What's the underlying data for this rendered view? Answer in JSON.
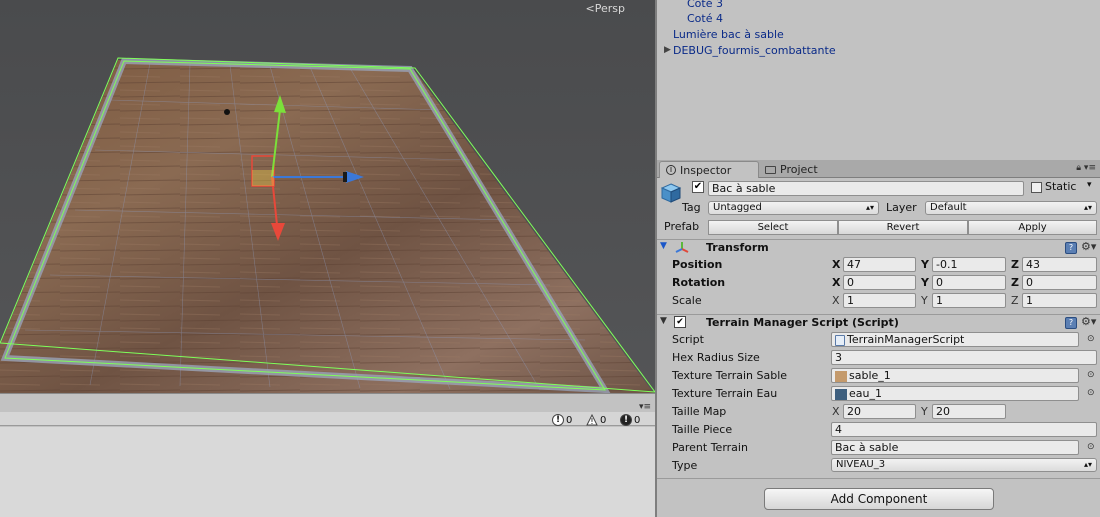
{
  "scene": {
    "projection_label": "Persp"
  },
  "console": {
    "log_count": "0",
    "warning_count": "0",
    "error_count": "0"
  },
  "hierarchy": {
    "items": [
      {
        "label": "Coté 3"
      },
      {
        "label": "Coté 4"
      },
      {
        "label": "Lumière bac à sable"
      },
      {
        "label": "DEBUG_fourmis_combattante"
      }
    ]
  },
  "inspector": {
    "tabs": [
      {
        "label": "Inspector"
      },
      {
        "label": "Project"
      }
    ],
    "object_name": "Bac à sable",
    "active_checked": true,
    "static_label": "Static",
    "tag_label": "Tag",
    "tag_value": "Untagged",
    "layer_label": "Layer",
    "layer_value": "Default",
    "prefab_label": "Prefab",
    "prefab_buttons": [
      "Select",
      "Revert",
      "Apply"
    ],
    "transform": {
      "title": "Transform",
      "position_label": "Position",
      "position": {
        "x": "47",
        "y": "-0.1",
        "z": "43"
      },
      "rotation_label": "Rotation",
      "rotation": {
        "x": "0",
        "y": "0",
        "z": "0"
      },
      "scale_label": "Scale",
      "scale": {
        "x": "1",
        "y": "1",
        "z": "1"
      }
    },
    "terrain_script": {
      "title": "Terrain Manager Script (Script)",
      "script_label": "Script",
      "script_value": "TerrainManagerScript",
      "hex_radius_label": "Hex Radius Size",
      "hex_radius_value": "3",
      "tex_sable_label": "Texture Terrain Sable",
      "tex_sable_value": "sable_1",
      "tex_sable_color": "#c49a6c",
      "tex_eau_label": "Texture Terrain Eau",
      "tex_eau_value": "eau_1",
      "tex_eau_color": "#3e5f7e",
      "taille_map_label": "Taille Map",
      "taille_map": {
        "x": "20",
        "y": "20"
      },
      "taille_piece_label": "Taille Piece",
      "taille_piece_value": "4",
      "parent_terrain_label": "Parent Terrain",
      "parent_terrain_value": "Bac à sable",
      "type_label": "Type",
      "type_value": "NIVEAU_3"
    },
    "add_component_label": "Add Component"
  },
  "axis_letters": {
    "x": "X",
    "y": "Y",
    "z": "Z"
  }
}
